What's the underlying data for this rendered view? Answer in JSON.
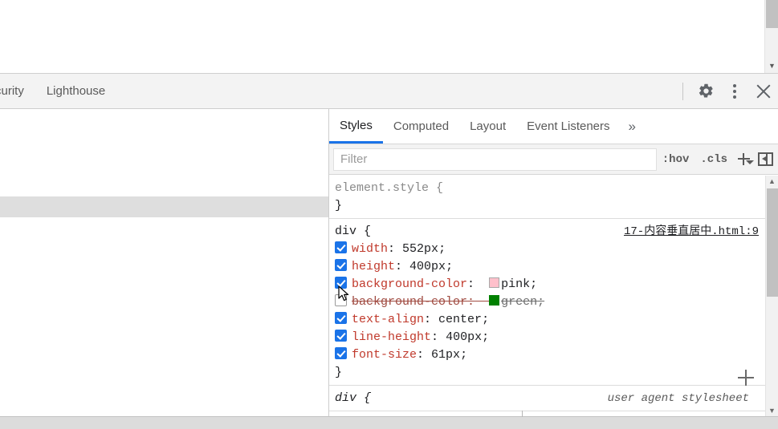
{
  "devtools": {
    "panel_tabs": [
      {
        "label": "curity",
        "name": "panel-tab-security",
        "active": false
      },
      {
        "label": "Lighthouse",
        "name": "panel-tab-lighthouse",
        "active": false
      }
    ],
    "toolbar_icons": [
      {
        "name": "settings-gear-icon",
        "label": "gear-icon"
      },
      {
        "name": "more-options-icon",
        "label": "three-dots-icon"
      },
      {
        "name": "close-devtools-icon",
        "label": "close-icon"
      }
    ]
  },
  "sidebar": {
    "tabs": [
      {
        "label": "Styles",
        "active": true
      },
      {
        "label": "Computed",
        "active": false
      },
      {
        "label": "Layout",
        "active": false
      },
      {
        "label": "Event Listeners",
        "active": false
      }
    ],
    "more_tabs_glyph": "»",
    "filter": {
      "placeholder": "Filter",
      "value": ""
    },
    "tools": {
      "hov": ":hov",
      "cls": ".cls",
      "new_style_rule": "+",
      "toggle_pane": "panel-toggle-icon"
    },
    "add_property_plus": "+"
  },
  "rules": [
    {
      "selector": "element.style",
      "selector_style": "gray",
      "open_brace": "{",
      "close_brace": "}",
      "origin": "",
      "origin_type": "none",
      "properties": []
    },
    {
      "selector": "div",
      "selector_style": "dark",
      "open_brace": "{",
      "close_brace": "}",
      "origin": "17-内容垂直居中.html:9",
      "origin_type": "link",
      "properties": [
        {
          "enabled": true,
          "name": "width",
          "value": "552px",
          "swatch": null,
          "colon": ":",
          "semicolon": ";"
        },
        {
          "enabled": true,
          "name": "height",
          "value": "400px",
          "swatch": null,
          "colon": ":",
          "semicolon": ";"
        },
        {
          "enabled": true,
          "name": "background-color",
          "value": "pink",
          "swatch": "#ffc0cb",
          "colon": ":",
          "semicolon": ";"
        },
        {
          "enabled": false,
          "name": "background-color",
          "value": "green",
          "swatch": "#008000",
          "colon": ":",
          "semicolon": ";"
        },
        {
          "enabled": true,
          "name": "text-align",
          "value": "center",
          "swatch": null,
          "colon": ":",
          "semicolon": ";"
        },
        {
          "enabled": true,
          "name": "line-height",
          "value": "400px",
          "swatch": null,
          "colon": ":",
          "semicolon": ";"
        },
        {
          "enabled": true,
          "name": "font-size",
          "value": "61px",
          "swatch": null,
          "colon": ":",
          "semicolon": ";"
        }
      ]
    },
    {
      "selector": "div",
      "selector_style": "ua",
      "open_brace": "{",
      "close_brace": "",
      "origin": "user agent stylesheet",
      "origin_type": "ua",
      "properties": []
    }
  ],
  "colors": {
    "accent": "#1a73e8",
    "property_name": "#c0392b",
    "pink_swatch": "#ffc0cb",
    "green_swatch": "#008000",
    "selected_row": "#dedede",
    "toolbar_bg": "#f3f3f3"
  }
}
